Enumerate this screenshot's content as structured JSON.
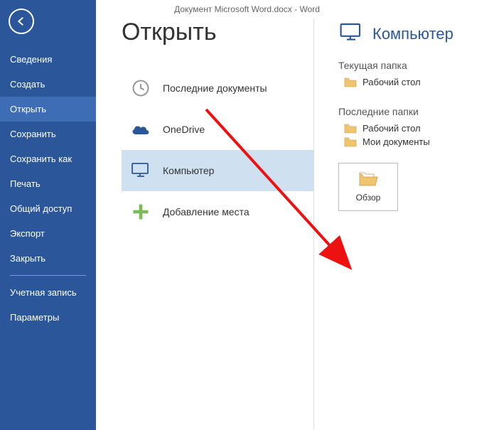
{
  "titlebar": "Документ Microsoft Word.docx - Word",
  "page_title": "Открыть",
  "sidebar": {
    "items": [
      {
        "label": "Сведения"
      },
      {
        "label": "Создать"
      },
      {
        "label": "Открыть"
      },
      {
        "label": "Сохранить"
      },
      {
        "label": "Сохранить как"
      },
      {
        "label": "Печать"
      },
      {
        "label": "Общий доступ"
      },
      {
        "label": "Экспорт"
      },
      {
        "label": "Закрыть"
      }
    ],
    "footer": [
      {
        "label": "Учетная запись"
      },
      {
        "label": "Параметры"
      }
    ]
  },
  "locations": {
    "recent": "Последние документы",
    "onedrive": "OneDrive",
    "computer": "Компьютер",
    "add_place": "Добавление места"
  },
  "right": {
    "title": "Компьютер",
    "current_folder_label": "Текущая папка",
    "current_folder": "Рабочий стол",
    "recent_folders_label": "Последние папки",
    "recent_folders": [
      "Рабочий стол",
      "Мои документы"
    ],
    "browse": "Обзор"
  }
}
